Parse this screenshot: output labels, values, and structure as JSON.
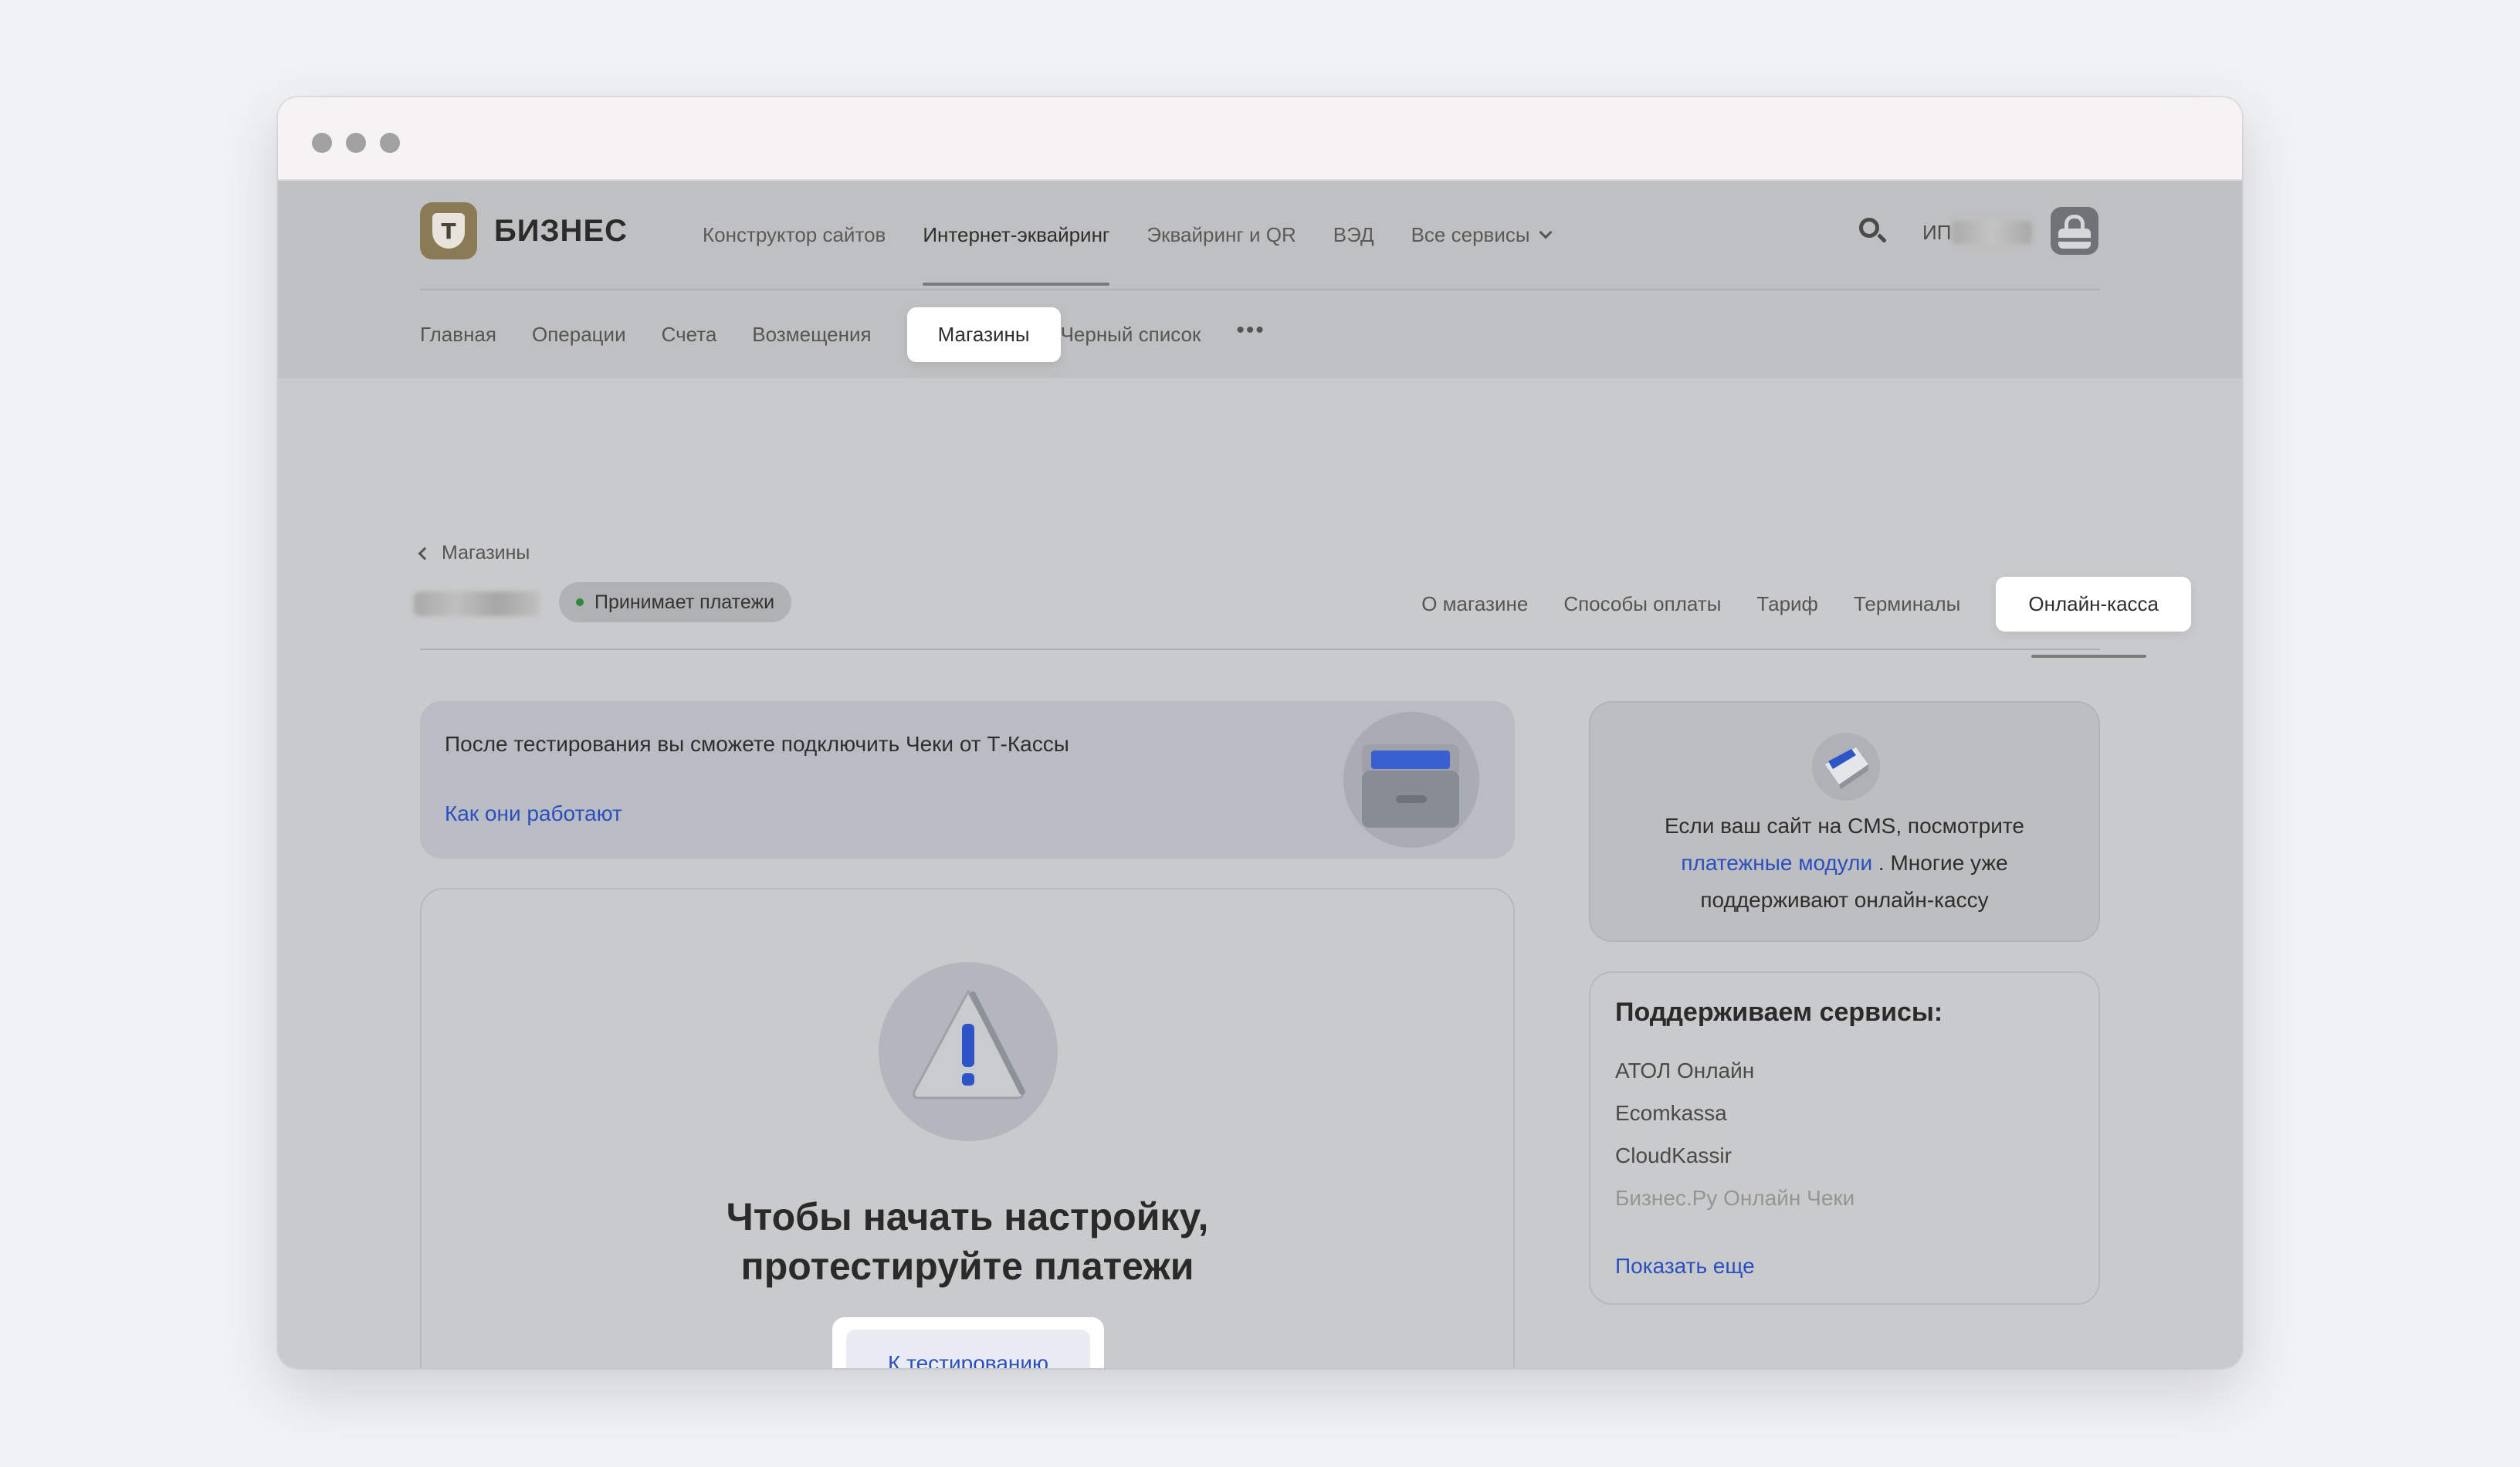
{
  "header": {
    "logo_text": "БИЗНЕС",
    "logo_mark": "Т",
    "nav": [
      "Конструктор сайтов",
      "Интернет-эквайринг",
      "Эквайринг и QR",
      "ВЭД",
      "Все сервисы"
    ],
    "user_label": "ИП"
  },
  "subnav": {
    "items": [
      "Главная",
      "Операции",
      "Счета",
      "Возмещения",
      "Магазины",
      "Черный список"
    ],
    "more": "•••"
  },
  "breadcrumb": "Магазины",
  "shop": {
    "status": "Принимает платежи",
    "status_color": "#2c8a3e",
    "tabs": [
      "О магазине",
      "Способы оплаты",
      "Тариф",
      "Терминалы",
      "Онлайн-касса"
    ]
  },
  "promo": {
    "text": "После тестирования вы сможете подключить Чеки от Т-Кассы",
    "link": "Как они работают"
  },
  "test": {
    "title_line1": "Чтобы начать настройку,",
    "title_line2": "протестируйте платежи",
    "button": "К тестированию"
  },
  "cms": {
    "text_before": "Если ваш сайт на CMS, посмотрите",
    "link": "платежные модули",
    "text_after": ". Многие уже поддерживают онлайн-кассу"
  },
  "services": {
    "title": "Поддерживаем сервисы:",
    "items": [
      "АТОЛ Онлайн",
      "Ecomkassa",
      "CloudKassir",
      "Бизнес.Ру Онлайн Чеки"
    ],
    "show_more": "Показать еще"
  },
  "colors": {
    "link": "#2c4fbf",
    "highlight": "#ffffff",
    "overlay": "#c9cacb"
  }
}
